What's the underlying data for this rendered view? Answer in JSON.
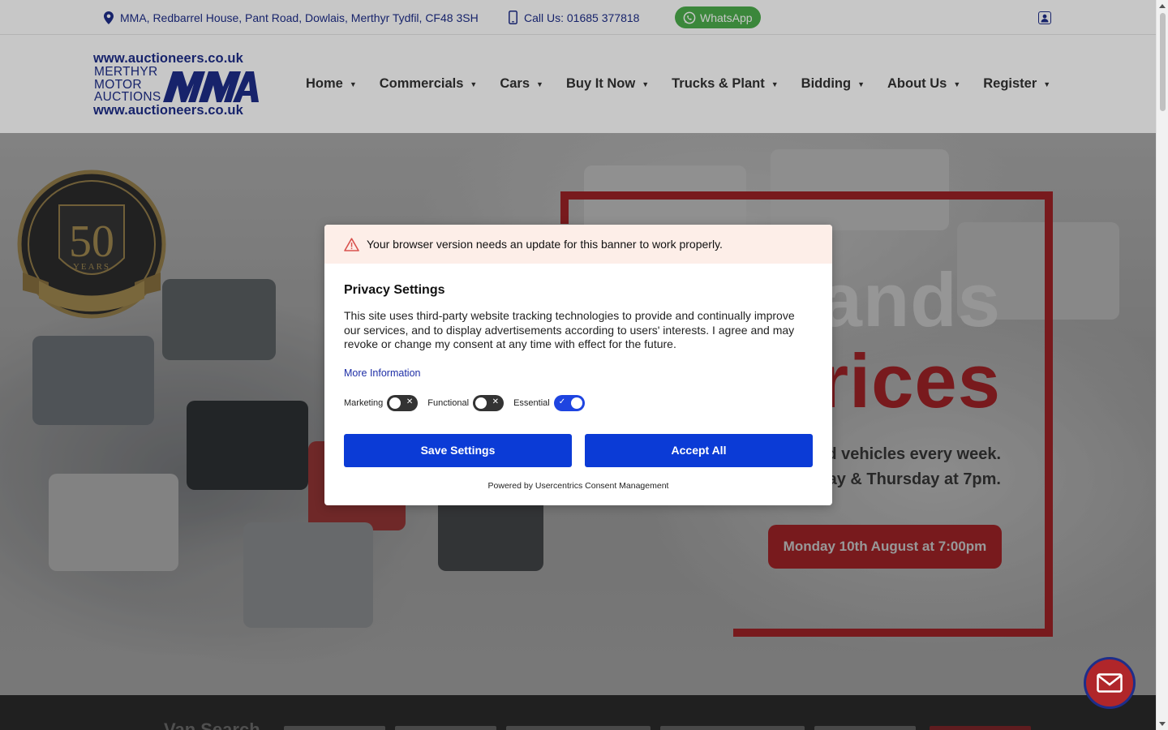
{
  "topbar": {
    "address": "MMA, Redbarrel House, Pant Road, Dowlais, Merthyr Tydfil, CF48 3SH",
    "phone": "Call Us: 01685 377818",
    "whatsapp": "WhatsApp"
  },
  "logo": {
    "url_top": "www.auctioneers.co.uk",
    "line1": "MERTHYR",
    "line2": "MOTOR",
    "line3": "AUCTIONS",
    "url_bottom": "www.auctioneers.co.uk"
  },
  "nav": {
    "items": [
      {
        "label": "Home"
      },
      {
        "label": "Commercials"
      },
      {
        "label": "Cars"
      },
      {
        "label": "Buy It Now"
      },
      {
        "label": "Trucks & Plant"
      },
      {
        "label": "Bidding"
      },
      {
        "label": "About Us"
      },
      {
        "label": "Register"
      }
    ]
  },
  "hero": {
    "badge_number": "50",
    "badge_text": "YEARS",
    "line1_visible": "ands",
    "line2_visible": "rices",
    "sub1_visible": "d vehicles every week.",
    "sub2_visible": "ay & Thursday at 7pm.",
    "cta": "Monday 10th August at 7:00pm"
  },
  "search_strip": {
    "title_visible": "Van Search"
  },
  "consent": {
    "warning": "Your browser version needs an update for this banner to work properly.",
    "title": "Privacy Settings",
    "text": "This site uses third-party website tracking technologies to provide and continually improve our services, and to display advertisements according to users' interests. I agree and may revoke or change my consent at any time with effect for the future.",
    "more_info": "More Information",
    "toggles": [
      {
        "label": "Marketing",
        "state": "off"
      },
      {
        "label": "Functional",
        "state": "off"
      },
      {
        "label": "Essential",
        "state": "on"
      }
    ],
    "save_button": "Save Settings",
    "accept_button": "Accept All",
    "footer": "Powered by Usercentrics Consent Management"
  },
  "colors": {
    "brand_blue": "#1e2e8a",
    "brand_red": "#c62026",
    "consent_button": "#0b3bd6",
    "whatsapp_green": "#4cae4c"
  }
}
